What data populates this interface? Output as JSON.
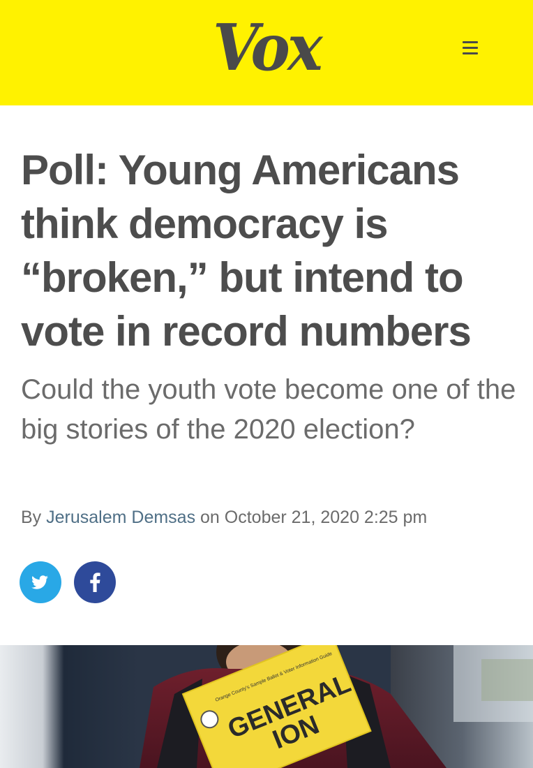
{
  "header": {
    "logo_text": "Vox",
    "background_color": "#fff200",
    "menu_icon": "hamburger-menu-icon"
  },
  "article": {
    "headline": "Poll: Young Americans think democracy is “broken,” but intend to vote in record numbers",
    "dek": "Could the youth vote become one of the big stories of the 2020 election?",
    "byline": {
      "prefix": "By ",
      "author": "Jerusalem Demsas",
      "on": " on ",
      "date": "October 21, 2020 2:25 pm"
    }
  },
  "share": {
    "twitter_icon": "twitter-icon",
    "twitter_color": "#29a8e6",
    "facebook_icon": "facebook-icon",
    "facebook_color": "#2e4a9a"
  },
  "hero_image": {
    "ballot_text_line1": "GENERAL",
    "ballot_text_line2": "ION",
    "ballot_small_text": "Orange County's Sample Ballot & Voter Information Guide"
  }
}
